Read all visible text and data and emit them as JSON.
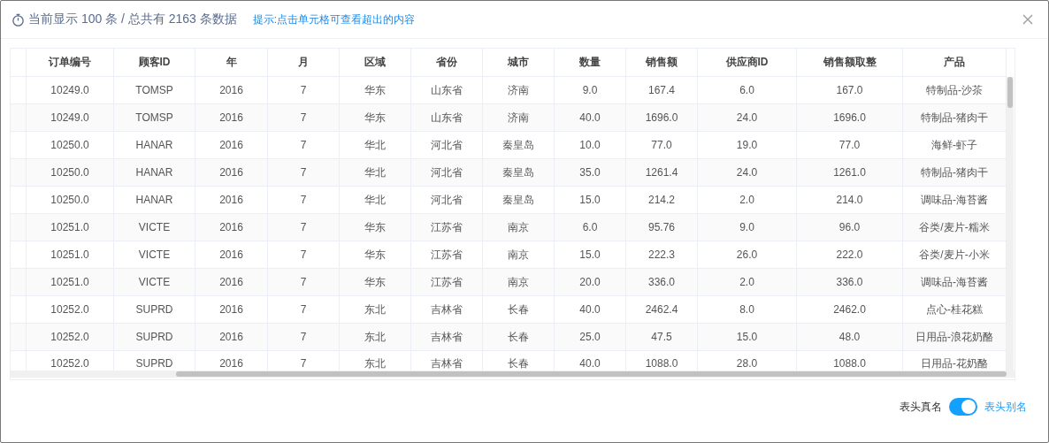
{
  "header": {
    "summary": "当前显示 100 条 / 总共有 2163 条数据",
    "hint": "提示:点击单元格可查看超出的内容"
  },
  "table": {
    "columns": [
      "订单编号",
      "顾客ID",
      "年",
      "月",
      "区域",
      "省份",
      "城市",
      "数量",
      "销售额",
      "供应商ID",
      "销售额取整",
      "产品"
    ],
    "rows": [
      [
        "10249.0",
        "TOMSP",
        "2016",
        "7",
        "华东",
        "山东省",
        "济南",
        "9.0",
        "167.4",
        "6.0",
        "167.0",
        "特制品-沙茶"
      ],
      [
        "10249.0",
        "TOMSP",
        "2016",
        "7",
        "华东",
        "山东省",
        "济南",
        "40.0",
        "1696.0",
        "24.0",
        "1696.0",
        "特制品-猪肉干"
      ],
      [
        "10250.0",
        "HANAR",
        "2016",
        "7",
        "华北",
        "河北省",
        "秦皇岛",
        "10.0",
        "77.0",
        "19.0",
        "77.0",
        "海鲜-虾子"
      ],
      [
        "10250.0",
        "HANAR",
        "2016",
        "7",
        "华北",
        "河北省",
        "秦皇岛",
        "35.0",
        "1261.4",
        "24.0",
        "1261.0",
        "特制品-猪肉干"
      ],
      [
        "10250.0",
        "HANAR",
        "2016",
        "7",
        "华北",
        "河北省",
        "秦皇岛",
        "15.0",
        "214.2",
        "2.0",
        "214.0",
        "调味品-海苔酱"
      ],
      [
        "10251.0",
        "VICTE",
        "2016",
        "7",
        "华东",
        "江苏省",
        "南京",
        "6.0",
        "95.76",
        "9.0",
        "96.0",
        "谷类/麦片-糯米"
      ],
      [
        "10251.0",
        "VICTE",
        "2016",
        "7",
        "华东",
        "江苏省",
        "南京",
        "15.0",
        "222.3",
        "26.0",
        "222.0",
        "谷类/麦片-小米"
      ],
      [
        "10251.0",
        "VICTE",
        "2016",
        "7",
        "华东",
        "江苏省",
        "南京",
        "20.0",
        "336.0",
        "2.0",
        "336.0",
        "调味品-海苔酱"
      ],
      [
        "10252.0",
        "SUPRD",
        "2016",
        "7",
        "东北",
        "吉林省",
        "长春",
        "40.0",
        "2462.4",
        "8.0",
        "2462.0",
        "点心-桂花糕"
      ],
      [
        "10252.0",
        "SUPRD",
        "2016",
        "7",
        "东北",
        "吉林省",
        "长春",
        "25.0",
        "47.5",
        "15.0",
        "48.0",
        "日用品-浪花奶酪"
      ],
      [
        "10252.0",
        "SUPRD",
        "2016",
        "7",
        "东北",
        "吉林省",
        "长春",
        "40.0",
        "1088.0",
        "28.0",
        "1088.0",
        "日用品-花奶酪"
      ]
    ]
  },
  "footer": {
    "toggle": {
      "off_label": "表头真名",
      "on_label": "表头别名",
      "on": true
    }
  }
}
